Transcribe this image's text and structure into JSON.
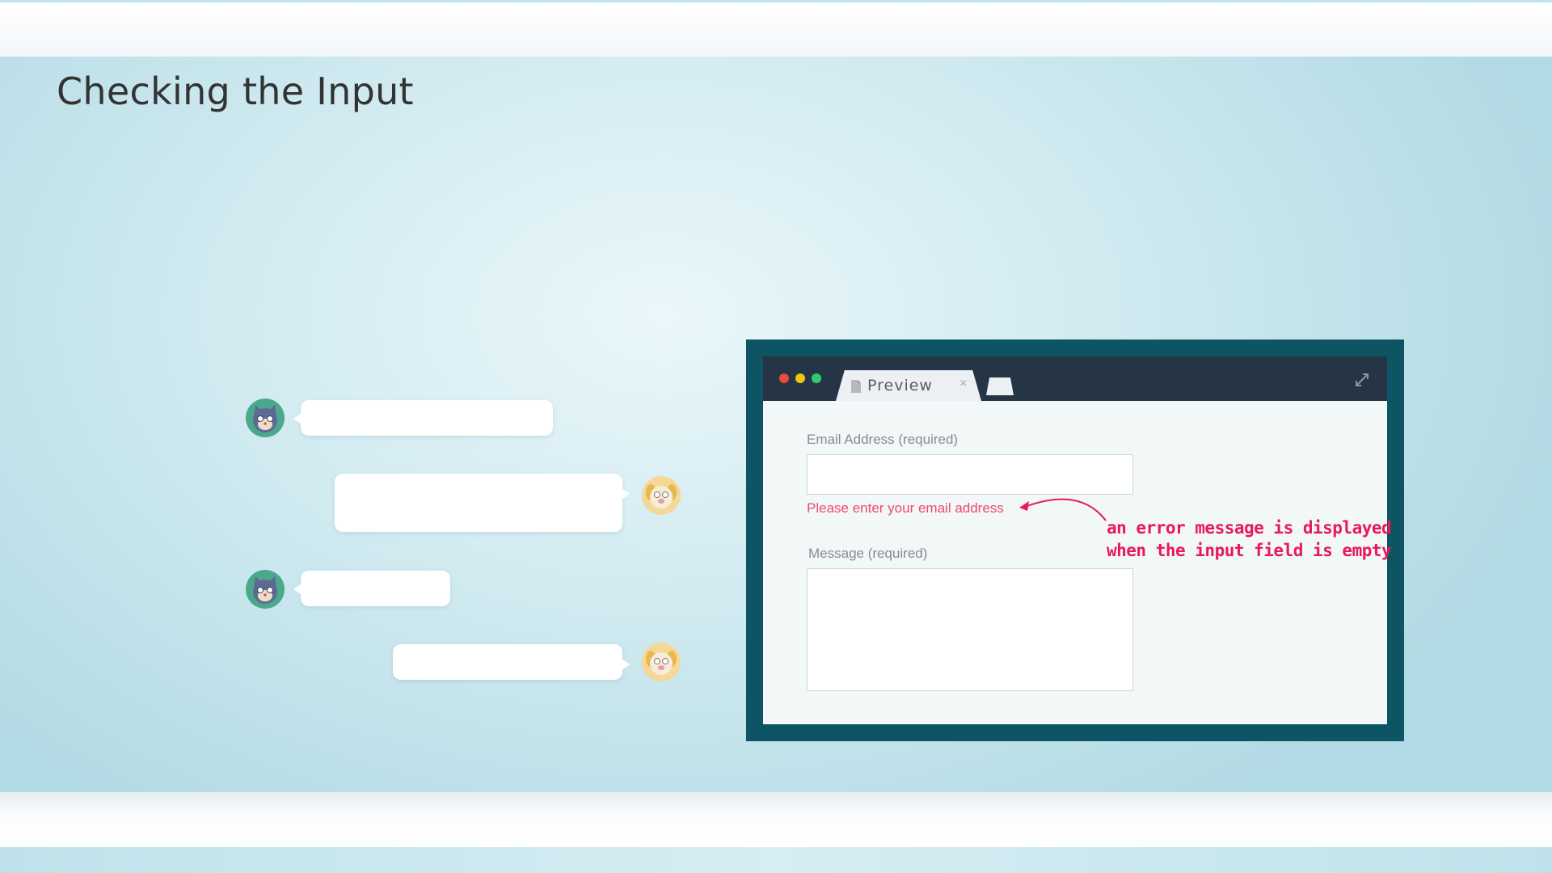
{
  "slide": {
    "title": "Checking the Input"
  },
  "browser": {
    "tab_label": "Preview",
    "tab_close_glyph": "×",
    "traffic_lights": [
      "#e74c3c",
      "#f1c40f",
      "#2ecc71"
    ]
  },
  "form": {
    "email_label": "Email Address (required)",
    "email_value": "",
    "error_message": "Please enter your email address",
    "message_label": "Message (required)",
    "message_value": ""
  },
  "annotation": {
    "line1": "an error message is displayed",
    "line2": "when the input field is empty"
  },
  "chat": {
    "avatars": [
      "cat-avatar-icon",
      "dog-avatar-icon"
    ]
  },
  "colors": {
    "error": "#ef4a6d",
    "annotation": "#e8195a",
    "frame": "#0d5565",
    "titlebar": "#263545"
  }
}
